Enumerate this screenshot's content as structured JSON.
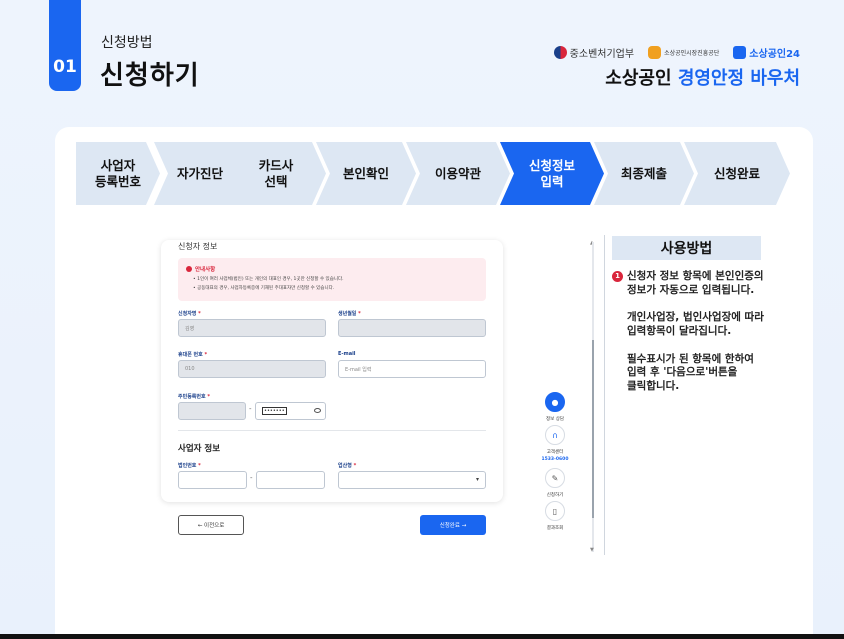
{
  "header": {
    "step_number": "01",
    "subtitle": "신청방법",
    "title": "신청하기",
    "logos": {
      "mss": "중소벤처기업부",
      "semas": "소상공인시장진흥공단",
      "sb24": "소상공인24"
    },
    "voucher_prefix": "소상공인",
    "voucher_title": "경영안정 바우처"
  },
  "steps": [
    {
      "label": "사업자\n등록번호",
      "active": false
    },
    {
      "label": "자가진단",
      "active": false
    },
    {
      "label": "카드사\n선택",
      "active": false
    },
    {
      "label": "본인확인",
      "active": false
    },
    {
      "label": "이용약관",
      "active": false
    },
    {
      "label": "신청정보\n입력",
      "active": true
    },
    {
      "label": "최종제출",
      "active": false
    },
    {
      "label": "신청완료",
      "active": false
    }
  ],
  "form": {
    "section_title": "신청자 정보",
    "notice_title": "안내사항",
    "notice_lines": [
      "• 1인이 여러 사업체(법인) 또는 개인의 대표인 경우, 1곳만 신청할 수 있습니다.",
      "• 공동대표의 경우, 사업자등록증에 기재된 주대표자만 신청할 수 있습니다."
    ],
    "name_label": "신청자명",
    "name_value": "김영",
    "birth_label": "생년월일",
    "phone_label": "휴대폰 번호",
    "phone_value": "010",
    "email_label": "E-mail",
    "email_placeholder": "E-mail 입력",
    "rrn_label": "주민등록번호",
    "rrn_masked": "•••••••",
    "required_mark": "*",
    "dash": "-",
    "biz_section_title": "사업자 정보",
    "corp_no_label": "법인번호",
    "industry_label": "업산형"
  },
  "nav": {
    "prev": "← 이전으로",
    "next": "신청완료 →"
  },
  "quick_menu": {
    "info_check": "정보 상담",
    "call_center": "고객센터",
    "phone": "1533-0600",
    "apply": "신청하기",
    "result": "결과조회"
  },
  "usage": {
    "title": "사용방법",
    "number": "1",
    "paragraphs": [
      "신청자 정보 항목에 본인인증의\n정보가 자동으로 입력됩니다.",
      "개인사업장, 법인사업장에 따라\n입력항목이 달라집니다.",
      "필수표시가 된 항목에 한하여\n입력 후 '다음으로'버튼을\n클릭합니다."
    ]
  },
  "colors": {
    "accent": "#1a66f0",
    "step_inactive": "#dde7f3",
    "alert": "#d9263c"
  }
}
